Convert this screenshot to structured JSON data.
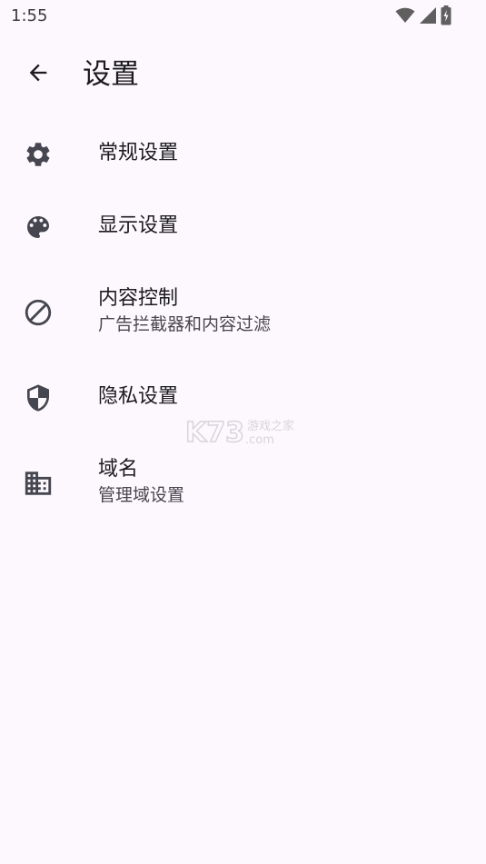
{
  "status_bar": {
    "time": "1:55",
    "icons": [
      "wifi-icon",
      "cell-signal-icon",
      "battery-charging-icon"
    ]
  },
  "app_bar": {
    "back_icon": "arrow-back-icon",
    "title": "设置"
  },
  "settings": {
    "items": [
      {
        "icon": "gear-icon",
        "title": "常规设置",
        "subtitle": ""
      },
      {
        "icon": "palette-icon",
        "title": "显示设置",
        "subtitle": ""
      },
      {
        "icon": "block-icon",
        "title": "内容控制",
        "subtitle": "广告拦截器和内容过滤"
      },
      {
        "icon": "shield-icon",
        "title": "隐私设置",
        "subtitle": ""
      },
      {
        "icon": "domain-icon",
        "title": "域名",
        "subtitle": "管理域设置"
      }
    ]
  },
  "watermark": {
    "brand": "K73",
    "tagline": "游戏之家",
    "domain": ".com"
  },
  "colors": {
    "background": "#fdf8fd",
    "icon": "#45464f",
    "text": "#1c1b1f",
    "subtext": "#49454f"
  }
}
